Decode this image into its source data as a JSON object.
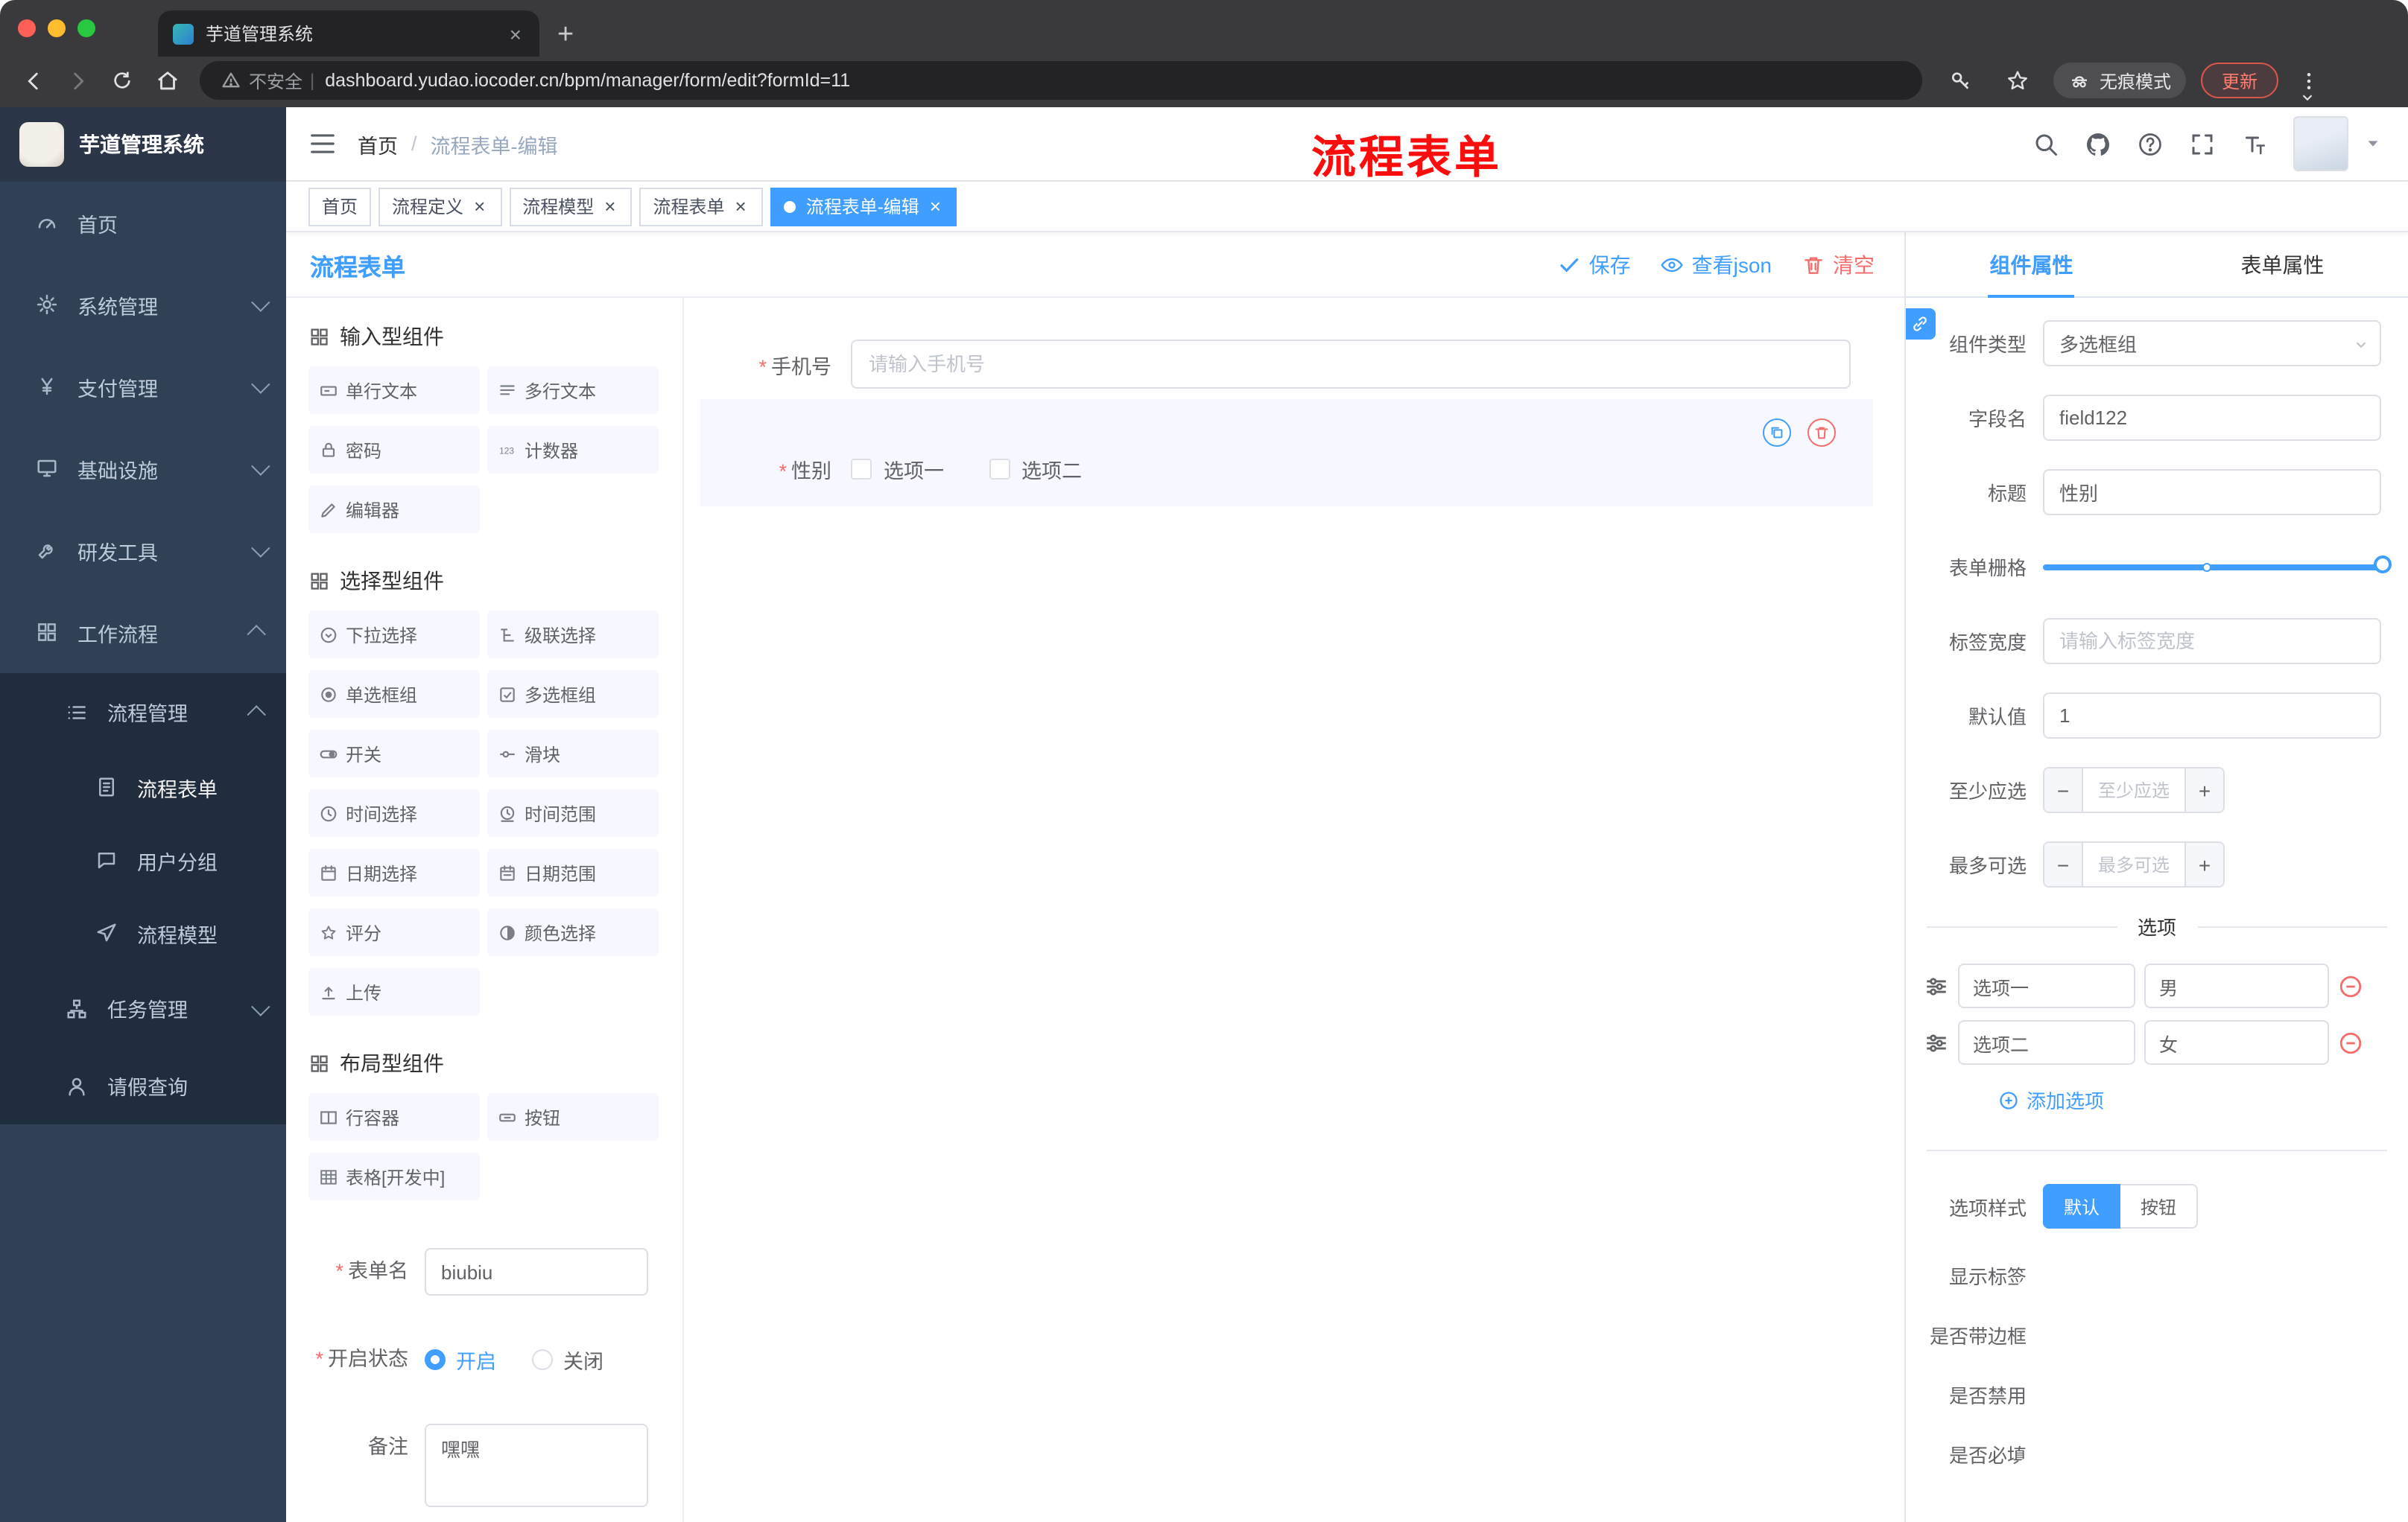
{
  "browser": {
    "tab_title": "芋道管理系统",
    "security_label": "不安全",
    "url": "dashboard.yudao.iocoder.cn/bpm/manager/form/edit?formId=11",
    "incognito_label": "无痕模式",
    "update_label": "更新"
  },
  "sidebar": {
    "logo_title": "芋道管理系统",
    "items": [
      {
        "label": "首页",
        "icon": "dashboard-icon",
        "level": 1
      },
      {
        "label": "系统管理",
        "icon": "gear-icon",
        "level": 1,
        "expanded": false
      },
      {
        "label": "支付管理",
        "icon": "yen-icon",
        "level": 1,
        "expanded": false
      },
      {
        "label": "基础设施",
        "icon": "monitor-icon",
        "level": 1,
        "expanded": false
      },
      {
        "label": "研发工具",
        "icon": "tool-icon",
        "level": 1,
        "expanded": false
      },
      {
        "label": "工作流程",
        "icon": "workflow-icon",
        "level": 1,
        "expanded": true
      },
      {
        "label": "流程管理",
        "icon": "list-icon",
        "level": 2,
        "expanded": true
      },
      {
        "label": "流程表单",
        "icon": "form-icon",
        "level": 3,
        "active": true
      },
      {
        "label": "用户分组",
        "icon": "chat-icon",
        "level": 3
      },
      {
        "label": "流程模型",
        "icon": "send-icon",
        "level": 3
      },
      {
        "label": "任务管理",
        "icon": "tree-icon",
        "level": 2,
        "expanded": false
      },
      {
        "label": "请假查询",
        "icon": "user-icon",
        "level": 2
      }
    ]
  },
  "navbar": {
    "breadcrumb": {
      "home": "首页",
      "separator": "/",
      "current": "流程表单-编辑"
    },
    "annotation": "流程表单"
  },
  "tags": [
    {
      "label": "首页",
      "closable": false,
      "active": false
    },
    {
      "label": "流程定义",
      "closable": true,
      "active": false
    },
    {
      "label": "流程模型",
      "closable": true,
      "active": false
    },
    {
      "label": "流程表单",
      "closable": true,
      "active": false
    },
    {
      "label": "流程表单-编辑",
      "closable": true,
      "active": true
    }
  ],
  "designer": {
    "title": "流程表单",
    "save_label": "保存",
    "view_json_label": "查看json",
    "clear_label": "清空",
    "palette": {
      "sections": [
        {
          "title": "输入型组件",
          "items": [
            {
              "label": "单行文本",
              "icon": "text-field-icon"
            },
            {
              "label": "多行文本",
              "icon": "textarea-icon"
            },
            {
              "label": "密码",
              "icon": "lock-icon"
            },
            {
              "label": "计数器",
              "icon": "counter-icon"
            },
            {
              "label": "编辑器",
              "icon": "editor-icon"
            }
          ]
        },
        {
          "title": "选择型组件",
          "items": [
            {
              "label": "下拉选择",
              "icon": "select-icon"
            },
            {
              "label": "级联选择",
              "icon": "cascade-icon"
            },
            {
              "label": "单选框组",
              "icon": "radio-group-icon"
            },
            {
              "label": "多选框组",
              "icon": "checkbox-group-icon"
            },
            {
              "label": "开关",
              "icon": "switch-icon"
            },
            {
              "label": "滑块",
              "icon": "slider-icon"
            },
            {
              "label": "时间选择",
              "icon": "time-icon"
            },
            {
              "label": "时间范围",
              "icon": "time-range-icon"
            },
            {
              "label": "日期选择",
              "icon": "date-icon"
            },
            {
              "label": "日期范围",
              "icon": "date-range-icon"
            },
            {
              "label": "评分",
              "icon": "rate-icon"
            },
            {
              "label": "颜色选择",
              "icon": "color-icon"
            },
            {
              "label": "上传",
              "icon": "upload-icon"
            }
          ]
        },
        {
          "title": "布局型组件",
          "items": [
            {
              "label": "行容器",
              "icon": "row-container-icon"
            },
            {
              "label": "按钮",
              "icon": "button-icon"
            },
            {
              "label": "表格[开发中]",
              "icon": "table-icon"
            }
          ]
        }
      ]
    },
    "meta": {
      "form_name_label": "表单名",
      "form_name_value": "biubiu",
      "status_label": "开启状态",
      "status_on": "开启",
      "status_off": "关闭",
      "status_value": "开启",
      "remark_label": "备注",
      "remark_value": "嘿嘿"
    },
    "canvas": {
      "phone_label": "手机号",
      "phone_placeholder": "请输入手机号",
      "gender_label": "性别",
      "gender_options": [
        {
          "label": "选项一",
          "checked": false
        },
        {
          "label": "选项二",
          "checked": false
        }
      ]
    }
  },
  "props": {
    "tab_component": "组件属性",
    "tab_form": "表单属性",
    "active_tab": "组件属性",
    "component_type_label": "组件类型",
    "component_type_value": "多选框组",
    "field_name_label": "字段名",
    "field_name_value": "field122",
    "title_label": "标题",
    "title_value": "性别",
    "grid_label": "表单栅格",
    "label_width_label": "标签宽度",
    "label_width_placeholder": "请输入标签宽度",
    "default_label": "默认值",
    "default_value": "1",
    "min_label": "至少应选",
    "min_placeholder": "至少应选",
    "max_label": "最多可选",
    "max_placeholder": "最多可选",
    "options_title": "选项",
    "options": [
      {
        "label": "选项一",
        "value": "男"
      },
      {
        "label": "选项二",
        "value": "女"
      }
    ],
    "add_option_label": "添加选项",
    "style_label": "选项样式",
    "style_default": "默认",
    "style_button": "按钮",
    "style_active": "默认",
    "toggles": [
      {
        "label": "显示标签",
        "on": true
      },
      {
        "label": "是否带边框",
        "on": false
      },
      {
        "label": "是否禁用",
        "on": false
      },
      {
        "label": "是否必填",
        "on": true
      }
    ]
  },
  "colors": {
    "primary": "#409eff",
    "danger": "#f56c6c",
    "annotation_red": "#fb0d0d",
    "sidebar_bg": "#304156",
    "submenu_bg": "#1f2d3d",
    "selected_field_bg": "#f6f7ff"
  }
}
